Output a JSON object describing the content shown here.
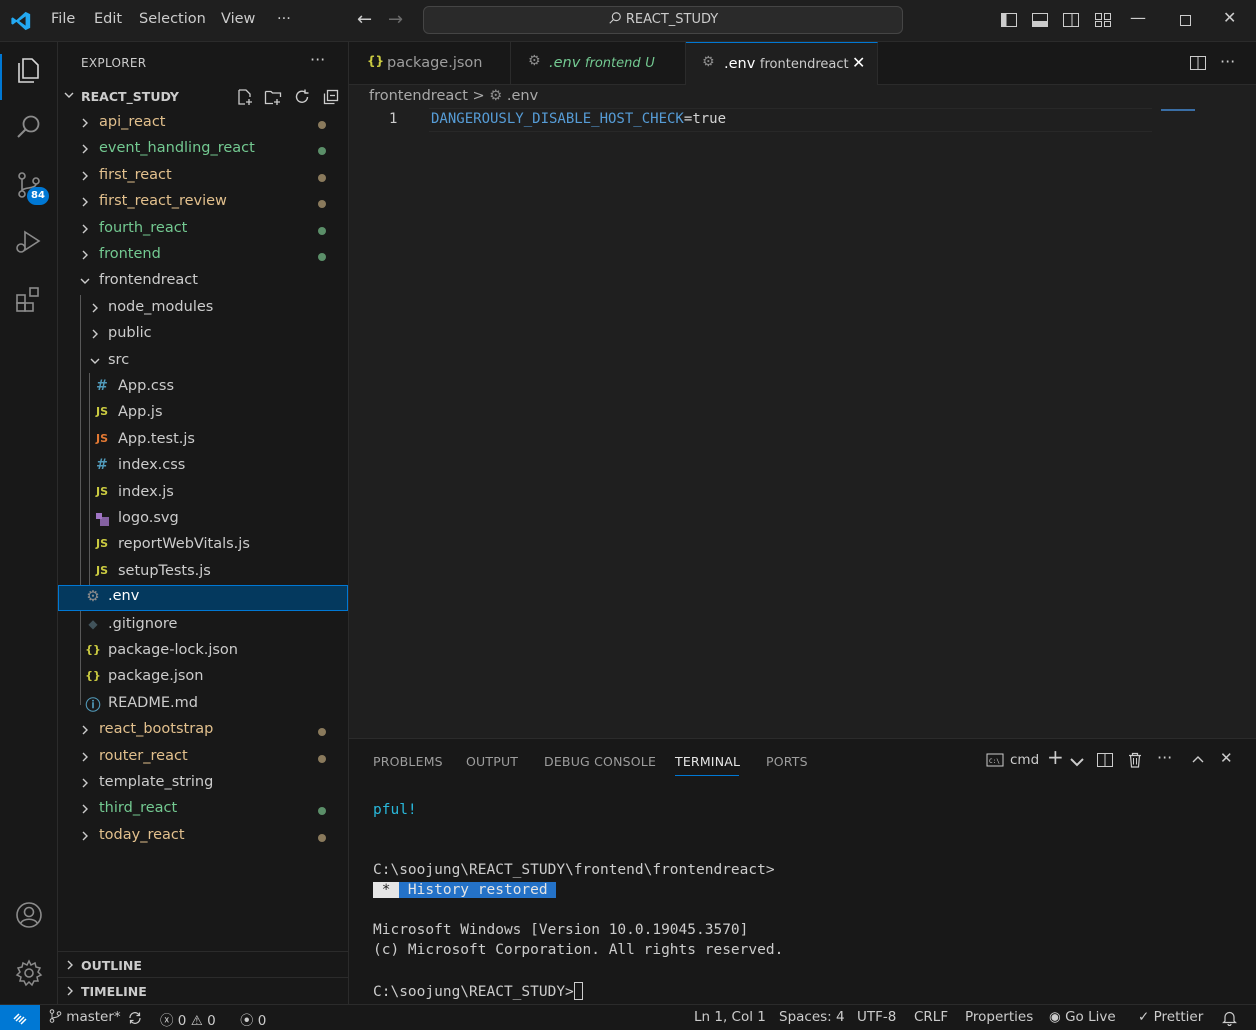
{
  "menu": {
    "file": "File",
    "edit": "Edit",
    "selection": "Selection",
    "view": "View",
    "more": "···"
  },
  "command_center": {
    "text": "REACT_STUDY",
    "icon": "search-icon"
  },
  "activity": {
    "scm_badge": "84"
  },
  "explorer": {
    "title": "EXPLORER",
    "more": "···",
    "root": "REACT_STUDY",
    "items": [
      {
        "label": "api_react",
        "color": "#e2c08d",
        "dot": "#8a7a5c"
      },
      {
        "label": "event_handling_react",
        "color": "#73c991",
        "dot": "#5b8f69"
      },
      {
        "label": "first_react",
        "color": "#e2c08d",
        "dot": "#8a7a5c"
      },
      {
        "label": "first_react_review",
        "color": "#e2c08d",
        "dot": "#8a7a5c"
      },
      {
        "label": "fourth_react",
        "color": "#73c991",
        "dot": "#5b8f69"
      },
      {
        "label": "frontend",
        "color": "#73c991",
        "dot": "#5b8f69"
      },
      {
        "label": "frontendreact",
        "color": "#cccccc"
      },
      {
        "label": "node_modules",
        "color": "#cccccc"
      },
      {
        "label": "public",
        "color": "#cccccc"
      },
      {
        "label": "src",
        "color": "#cccccc"
      },
      {
        "label": "App.css",
        "icon": "#",
        "icon_color": "#519aba"
      },
      {
        "label": "App.js",
        "icon": "JS",
        "icon_color": "#cbcb41"
      },
      {
        "label": "App.test.js",
        "icon": "JS",
        "icon_color": "#e37933"
      },
      {
        "label": "index.css",
        "icon": "#",
        "icon_color": "#519aba"
      },
      {
        "label": "index.js",
        "icon": "JS",
        "icon_color": "#cbcb41"
      },
      {
        "label": "logo.svg",
        "icon": "svg",
        "icon_color": "#a074c4"
      },
      {
        "label": "reportWebVitals.js",
        "icon": "JS",
        "icon_color": "#cbcb41"
      },
      {
        "label": "setupTests.js",
        "icon": "JS",
        "icon_color": "#cbcb41"
      },
      {
        "label": ".env",
        "icon": "⚙",
        "icon_color": "#8c8c8c"
      },
      {
        "label": ".gitignore",
        "icon": "◆",
        "icon_color": "#41535b"
      },
      {
        "label": "package-lock.json",
        "icon": "{}",
        "icon_color": "#cbcb41"
      },
      {
        "label": "package.json",
        "icon": "{}",
        "icon_color": "#cbcb41"
      },
      {
        "label": "README.md",
        "icon": "ⓘ",
        "icon_color": "#519aba"
      },
      {
        "label": "react_bootstrap",
        "color": "#e2c08d",
        "dot": "#8a7a5c"
      },
      {
        "label": "router_react",
        "color": "#e2c08d",
        "dot": "#8a7a5c"
      },
      {
        "label": "template_string",
        "color": "#cccccc"
      },
      {
        "label": "third_react",
        "color": "#73c991",
        "dot": "#5b8f69"
      },
      {
        "label": "today_react",
        "color": "#e2c08d",
        "dot": "#8a7a5c"
      }
    ],
    "outline": "OUTLINE",
    "timeline": "TIMELINE"
  },
  "tabs": [
    {
      "icon": "{}",
      "label": "package.json"
    },
    {
      "icon": "⚙",
      "label": ".env",
      "desc": "frontend",
      "status": "U"
    },
    {
      "icon": "⚙",
      "label": ".env",
      "desc": "frontendreact",
      "close": "✕"
    }
  ],
  "breadcrumb": {
    "folder": "frontendreact",
    "sep": ">",
    "file": ".env"
  },
  "editor": {
    "line_number": "1",
    "key": "DANGEROUSLY_DISABLE_HOST_CHECK",
    "eq": "=",
    "value": "true"
  },
  "panel": {
    "tabs": [
      "PROBLEMS",
      "OUTPUT",
      "DEBUG CONSOLE",
      "TERMINAL",
      "PORTS"
    ],
    "shell": "cmd",
    "terminal": {
      "line1": "pful!",
      "line2": "C:\\soojung\\REACT_STUDY\\frontend\\frontendreact>",
      "restored_star": " * ",
      "restored_text": " History restored ",
      "line4": "Microsoft Windows [Version 10.0.19045.3570]",
      "line5": "(c) Microsoft Corporation. All rights reserved.",
      "prompt": "C:\\soojung\\REACT_STUDY>"
    }
  },
  "status": {
    "branch": "master*",
    "errors": "0",
    "warnings": "0",
    "ports": "0",
    "position": "Ln 1, Col 1",
    "spaces": "Spaces: 4",
    "encoding": "UTF-8",
    "eol": "CRLF",
    "language": "Properties",
    "golive": "Go Live",
    "prettier": "Prettier"
  }
}
